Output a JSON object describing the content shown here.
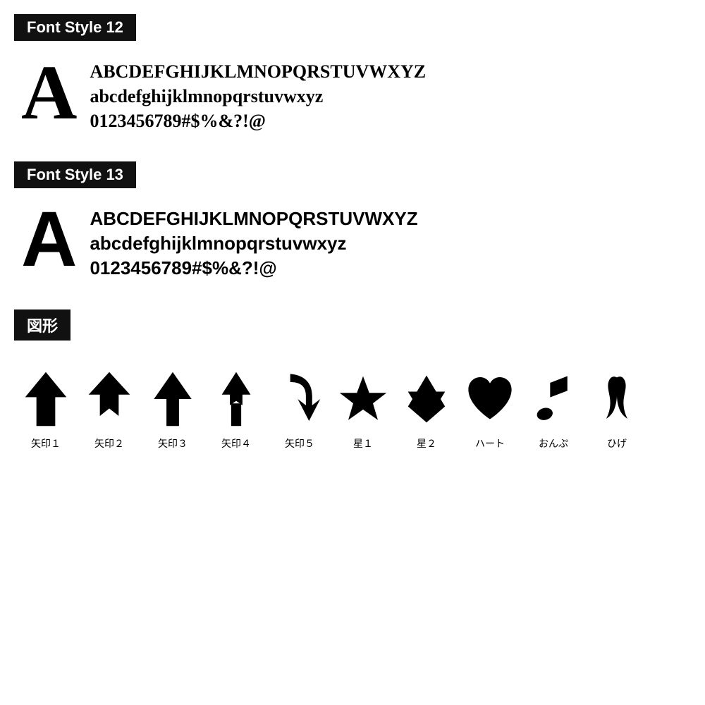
{
  "font12": {
    "label": "Font Style 12",
    "bigLetter": "A",
    "lines": [
      "ABCDEFGHIJKLMNOPQRSTUVWXYZ",
      "abcdefghijklmnopqrstuvwxyz",
      "0123456789#$%&?!@"
    ]
  },
  "font13": {
    "label": "Font Style 13",
    "bigLetter": "A",
    "lines": [
      "ABCDEFGHIJKLMNOPQRSTUVWXYZ",
      "abcdefghijklmnopqrstuvwxyz",
      "0123456789#$%&?!@"
    ]
  },
  "shapes": {
    "label": "図形",
    "items": [
      {
        "name": "矢印１"
      },
      {
        "name": "矢印２"
      },
      {
        "name": "矢印３"
      },
      {
        "name": "矢印４"
      },
      {
        "name": "矢印５"
      },
      {
        "name": "星１"
      },
      {
        "name": "星２"
      },
      {
        "name": "ハート"
      },
      {
        "name": "おんぷ"
      },
      {
        "name": "ひげ"
      }
    ]
  }
}
